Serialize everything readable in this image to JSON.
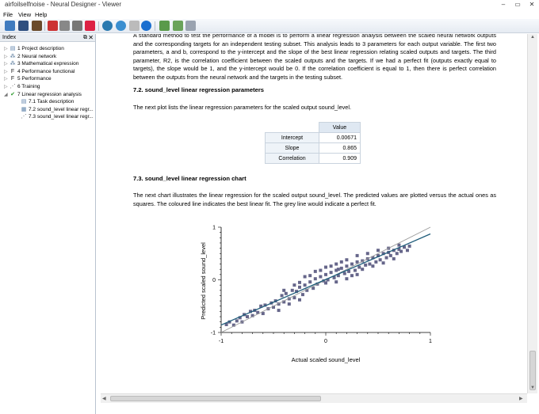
{
  "window": {
    "title": "airfoilselfnoise - Neural Designer - Viewer"
  },
  "menu": [
    "File",
    "View",
    "Help"
  ],
  "toolbar": {
    "icons": [
      "new-icon",
      "save-icon",
      "edit-icon",
      "report-icon",
      "pdf-icon",
      "print-icon",
      "print-preview-icon",
      "settings-icon",
      "web-icon",
      "globe-icon",
      "pencil-icon",
      "info-icon",
      "export-icon",
      "table-icon",
      "window-icon"
    ]
  },
  "index": {
    "title": "Index",
    "items": [
      {
        "label": "1 Project description",
        "icon": "document-icon",
        "level": 0,
        "expander": "▷"
      },
      {
        "label": "2 Neural network",
        "icon": "network-icon",
        "level": 0,
        "expander": "▷"
      },
      {
        "label": "3 Mathematical expression",
        "icon": "network-icon",
        "level": 0,
        "expander": "▷"
      },
      {
        "label": "4 Performance functional",
        "icon": "function-icon",
        "level": 0,
        "expander": "▷"
      },
      {
        "label": "5 Performance",
        "icon": "function-icon",
        "level": 0,
        "expander": "▷"
      },
      {
        "label": "6 Training",
        "icon": "training-icon",
        "level": 0,
        "expander": "▷"
      },
      {
        "label": "7 Linear regression analysis",
        "icon": "checkmark-icon",
        "level": 0,
        "expander": "◢"
      },
      {
        "label": "7.1 Task description",
        "icon": "document-icon",
        "level": 1,
        "expander": ""
      },
      {
        "label": "7.2 sound_level linear regr...",
        "icon": "list-icon",
        "level": 1,
        "expander": ""
      },
      {
        "label": "7.3 sound_level linear regr...",
        "icon": "chart-icon",
        "level": 1,
        "expander": ""
      }
    ]
  },
  "content": {
    "intro": "A standard method to test the performance of a model is to perform a linear regression analysis between the scaled neural network outputs and the corresponding targets for an independent testing subset. This analysis leads to 3 parameters for each output variable. The first two parameters, a and b, correspond to the y-intercept and the slope of the best linear regression relating scaled outputs and targets. The third parameter, R2, is the correlation coefficient between the scaled outputs and the targets. If we had a perfect fit (outputs exactly equal to targets), the slope would be 1, and the y-intercept would be 0. If the correlation coefficient is equal to 1, then there is perfect correlation between the outputs from the neural network and the targets in the testing subset.",
    "section2_title": "7.2. sound_level linear regression parameters",
    "section2_text": "The next plot lists the linear regression parameters for the scaled output sound_level.",
    "table": {
      "header": "Value",
      "rows": [
        {
          "label": "Intercept",
          "value": "0.00671"
        },
        {
          "label": "Slope",
          "value": "0.865"
        },
        {
          "label": "Correlation",
          "value": "0.909"
        }
      ]
    },
    "section3_title": "7.3. sound_level linear regression chart",
    "section3_text": "The next chart illustrates the linear regression for the scaled output sound_level. The predicted values are plotted versus the actual ones as squares. The coloured line indicates the best linear fit. The grey line would indicate a perfect fit."
  },
  "chart_data": {
    "type": "scatter",
    "xlabel": "Actual scaled sound_level",
    "ylabel": "Predicted scaled sound_level",
    "xlim": [
      -1,
      1
    ],
    "ylim": [
      -1,
      1
    ],
    "x_ticks": [
      "-1",
      "0",
      "1"
    ],
    "y_ticks": [
      "1",
      "0",
      "-1"
    ],
    "fit_line": {
      "intercept": 0.00671,
      "slope": 0.865,
      "color": "#1f5c7a"
    },
    "perfect_line": {
      "intercept": 0,
      "slope": 1,
      "color": "#9a9a9a"
    },
    "marker_color": "#66668a",
    "points": [
      [
        -0.95,
        -0.85
      ],
      [
        -0.92,
        -0.8
      ],
      [
        -0.88,
        -0.86
      ],
      [
        -0.85,
        -0.78
      ],
      [
        -0.82,
        -0.72
      ],
      [
        -0.8,
        -0.8
      ],
      [
        -0.78,
        -0.66
      ],
      [
        -0.75,
        -0.7
      ],
      [
        -0.72,
        -0.6
      ],
      [
        -0.7,
        -0.68
      ],
      [
        -0.68,
        -0.58
      ],
      [
        -0.65,
        -0.62
      ],
      [
        -0.62,
        -0.5
      ],
      [
        -0.6,
        -0.64
      ],
      [
        -0.58,
        -0.48
      ],
      [
        -0.55,
        -0.55
      ],
      [
        -0.52,
        -0.44
      ],
      [
        -0.5,
        -0.52
      ],
      [
        -0.48,
        -0.4
      ],
      [
        -0.45,
        -0.46
      ],
      [
        -0.42,
        -0.3
      ],
      [
        -0.4,
        -0.42
      ],
      [
        -0.38,
        -0.26
      ],
      [
        -0.35,
        -0.36
      ],
      [
        -0.32,
        -0.2
      ],
      [
        -0.3,
        -0.34
      ],
      [
        -0.28,
        -0.22
      ],
      [
        -0.25,
        -0.14
      ],
      [
        -0.22,
        -0.28
      ],
      [
        -0.2,
        -0.1
      ],
      [
        -0.18,
        -0.2
      ],
      [
        -0.15,
        -0.04
      ],
      [
        -0.12,
        -0.16
      ],
      [
        -0.1,
        0.02
      ],
      [
        -0.08,
        -0.08
      ],
      [
        -0.05,
        0.06
      ],
      [
        -0.02,
        -0.02
      ],
      [
        0.0,
        0.1
      ],
      [
        0.02,
        0.0
      ],
      [
        0.05,
        0.14
      ],
      [
        0.08,
        0.04
      ],
      [
        0.1,
        0.18
      ],
      [
        0.12,
        0.08
      ],
      [
        0.15,
        0.22
      ],
      [
        0.18,
        0.12
      ],
      [
        0.2,
        0.26
      ],
      [
        0.22,
        0.16
      ],
      [
        0.25,
        0.3
      ],
      [
        0.28,
        0.18
      ],
      [
        0.3,
        0.34
      ],
      [
        0.32,
        0.24
      ],
      [
        0.35,
        0.36
      ],
      [
        0.38,
        0.28
      ],
      [
        0.4,
        0.4
      ],
      [
        0.42,
        0.3
      ],
      [
        0.45,
        0.42
      ],
      [
        0.48,
        0.34
      ],
      [
        0.5,
        0.46
      ],
      [
        0.52,
        0.38
      ],
      [
        0.55,
        0.5
      ],
      [
        0.58,
        0.42
      ],
      [
        0.6,
        0.52
      ],
      [
        0.62,
        0.46
      ],
      [
        0.65,
        0.56
      ],
      [
        0.68,
        0.5
      ],
      [
        0.7,
        0.58
      ],
      [
        0.72,
        0.54
      ],
      [
        0.75,
        0.62
      ],
      [
        0.78,
        0.56
      ],
      [
        0.8,
        0.64
      ],
      [
        -0.3,
        -0.1
      ],
      [
        -0.2,
        0.06
      ],
      [
        -0.1,
        0.16
      ],
      [
        0.0,
        0.24
      ],
      [
        0.1,
        0.3
      ],
      [
        0.2,
        0.38
      ],
      [
        -0.4,
        -0.2
      ],
      [
        -0.25,
        -0.05
      ],
      [
        -0.05,
        0.18
      ],
      [
        0.05,
        0.26
      ],
      [
        0.15,
        0.34
      ],
      [
        0.3,
        0.46
      ],
      [
        0.4,
        0.5
      ],
      [
        0.5,
        0.56
      ],
      [
        0.6,
        0.6
      ],
      [
        0.7,
        0.66
      ],
      [
        -0.15,
        0.08
      ],
      [
        0.0,
        -0.06
      ],
      [
        0.1,
        -0.04
      ],
      [
        0.2,
        0.02
      ],
      [
        0.3,
        0.1
      ],
      [
        -0.35,
        -0.46
      ],
      [
        -0.25,
        -0.38
      ],
      [
        -0.45,
        -0.58
      ],
      [
        0.45,
        0.26
      ],
      [
        0.55,
        0.32
      ],
      [
        0.65,
        0.4
      ],
      [
        0.35,
        0.2
      ],
      [
        0.25,
        0.08
      ],
      [
        0.12,
        0.2
      ]
    ]
  }
}
